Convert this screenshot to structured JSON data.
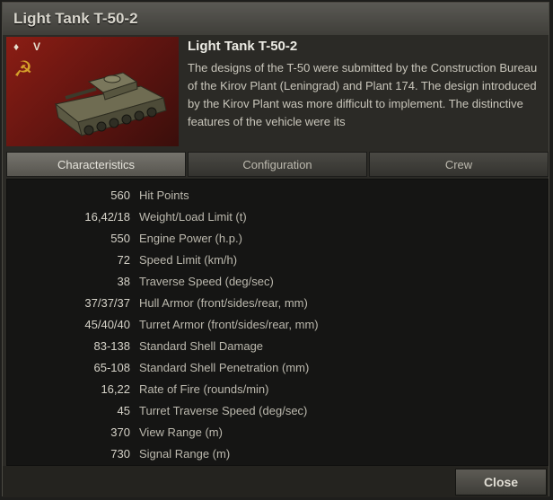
{
  "window": {
    "title": "Light Tank T-50-2"
  },
  "vehicle": {
    "nation_icon": "hammer-sickle-icon",
    "premium_marker": "♦",
    "tier": "V",
    "name": "Light Tank T-50-2",
    "description": "The designs of the T-50 were submitted by the Construction Bureau of the Kirov Plant (Leningrad) and Plant 174. The design introduced by the Kirov Plant was more difficult to implement. The distinctive features of the vehicle were its"
  },
  "tabs": [
    {
      "label": "Characteristics",
      "active": true
    },
    {
      "label": "Configuration",
      "active": false
    },
    {
      "label": "Crew",
      "active": false
    }
  ],
  "stats": [
    {
      "value": "560",
      "label": "Hit Points"
    },
    {
      "value": "16,42/18",
      "label": "Weight/Load Limit (t)"
    },
    {
      "value": "550",
      "label": "Engine Power (h.p.)"
    },
    {
      "value": "72",
      "label": "Speed Limit (km/h)"
    },
    {
      "value": "38",
      "label": "Traverse Speed (deg/sec)"
    },
    {
      "value": "37/37/37",
      "label": "Hull Armor (front/sides/rear, mm)"
    },
    {
      "value": "45/40/40",
      "label": "Turret Armor (front/sides/rear, mm)"
    },
    {
      "value": "83-138",
      "label": "Standard Shell Damage"
    },
    {
      "value": "65-108",
      "label": "Standard Shell Penetration (mm)"
    },
    {
      "value": "16,22",
      "label": "Rate of Fire (rounds/min)"
    },
    {
      "value": "45",
      "label": "Turret Traverse Speed (deg/sec)"
    },
    {
      "value": "370",
      "label": "View Range (m)"
    },
    {
      "value": "730",
      "label": "Signal Range (m)"
    }
  ],
  "footer": {
    "close_label": "Close"
  }
}
